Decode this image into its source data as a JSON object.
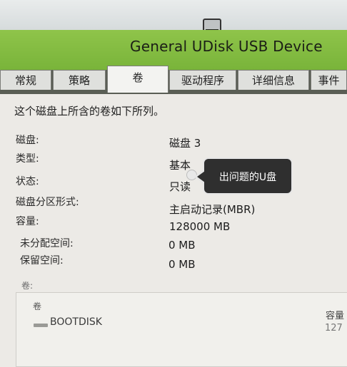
{
  "window": {
    "title": "General UDisk USB Device"
  },
  "tabs": [
    {
      "label": "常规"
    },
    {
      "label": "策略"
    },
    {
      "label": "卷",
      "active": true
    },
    {
      "label": "驱动程序"
    },
    {
      "label": "详细信息"
    },
    {
      "label": "事件"
    }
  ],
  "caption": "这个磁盘上所含的卷如下所列。",
  "properties": [
    {
      "label": "磁盘:",
      "value": "磁盘 3"
    },
    {
      "label": "类型:",
      "value": "基本"
    },
    {
      "label": "状态:",
      "value": "只读"
    },
    {
      "label": "磁盘分区形式:",
      "value": "主启动记录(MBR)"
    },
    {
      "label": "容量:",
      "value": "128000 MB"
    },
    {
      "label": "未分配空间:",
      "value": "0 MB"
    },
    {
      "label": "保留空间:",
      "value": "0 MB"
    }
  ],
  "annotation": {
    "text": "出问题的U盘"
  },
  "volumes": {
    "section_label": "卷:",
    "columns": [
      "卷",
      "容量"
    ],
    "rows": [
      {
        "name": "BOOTDISK",
        "capacity": "127"
      }
    ]
  },
  "icons": {
    "drive": "usb-drive-icon",
    "volume": "volume-icon"
  },
  "colors": {
    "title_bar": "#79b43a",
    "annotation_bg": "#2f2f2f"
  }
}
